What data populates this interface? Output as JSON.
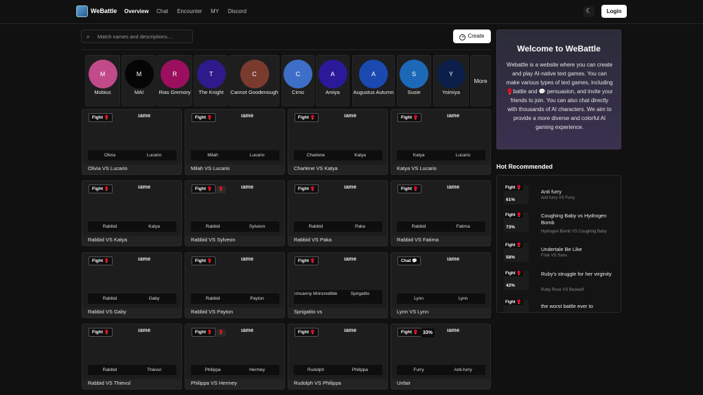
{
  "header": {
    "brand": "WeBattle",
    "nav": [
      "Overview",
      "Chat",
      "Encounter",
      "MY",
      "Discord"
    ],
    "login_label": "Login",
    "theme_icon": "moon-icon"
  },
  "toolbar": {
    "search_placeholder": "Match names and descriptions....",
    "create_label": "Create"
  },
  "characters": [
    {
      "initial": "M",
      "name": "Mobius",
      "color": "#c04a8a"
    },
    {
      "initial": "M",
      "name": "MAI",
      "color": "#050505"
    },
    {
      "initial": "R",
      "name": "Rias Gremory",
      "color": "#9c0f5f"
    },
    {
      "initial": "T",
      "name": "The Knight",
      "color": "#2e1a8a"
    },
    {
      "initial": "C",
      "name": "Cannot Goodenough",
      "color": "#7a3b2e"
    },
    {
      "initial": "C",
      "name": "Cirno",
      "color": "#3e6fc8"
    },
    {
      "initial": "A",
      "name": "Amiya",
      "color": "#2a1a9a"
    },
    {
      "initial": "A",
      "name": "Augustus Autumn",
      "color": "#1a4ab0"
    },
    {
      "initial": "S",
      "name": "Susie",
      "color": "#1e68b8"
    },
    {
      "initial": "Y",
      "name": "Yoimiya",
      "color": "#0b1f4a"
    }
  ],
  "more_label": "More",
  "ghost_text": "ıame",
  "cards": [
    {
      "type": "Fight",
      "a": "Olivia",
      "b": "Lucario",
      "title": "Olivia VS Lucario"
    },
    {
      "type": "Fight",
      "a": "Milah",
      "b": "Lucario",
      "title": "Milah VS Lucario"
    },
    {
      "type": "Fight",
      "a": "Charlene",
      "b": "Katya",
      "title": "Charlene VS Katya"
    },
    {
      "type": "Fight",
      "a": "Katya",
      "b": "Lucario",
      "title": "Katya VS Lucario"
    },
    {
      "type": "Fight",
      "a": "Rabbid",
      "b": "Katya",
      "title": "Rabbid VS Katya"
    },
    {
      "type": "Fight",
      "a": "Rabbid",
      "b": "Sylveon",
      "title": "Rabbid VS Sylveon",
      "extra": true
    },
    {
      "type": "Fight",
      "a": "Rabbid",
      "b": "Paka",
      "title": "Rabbid VS Paka"
    },
    {
      "type": "Fight",
      "a": "Rabbid",
      "b": "Fatima",
      "title": "Rabbid VS Fatima"
    },
    {
      "type": "Fight",
      "a": "Rabbid",
      "b": "Gaby",
      "title": "Rabbid VS Gaby"
    },
    {
      "type": "Fight",
      "a": "Rabbid",
      "b": "Payton",
      "title": "Rabbid VS Payton"
    },
    {
      "type": "Fight",
      "a": "Uncanny Mrincredible",
      "b": "Sprigatito",
      "title": "Sprigatito vs",
      "tall": true
    },
    {
      "type": "Chat",
      "a": "Lynn",
      "b": "Lynn",
      "title": "Lynn VS Lynn"
    },
    {
      "type": "Fight",
      "a": "Rabbid",
      "b": "Thievul",
      "title": "Rabbid VS Thievul"
    },
    {
      "type": "Fight",
      "a": "Philippa",
      "b": "Hermey",
      "title": "Philippa VS Hermey",
      "extra": true
    },
    {
      "type": "Fight",
      "a": "Rudolph",
      "b": "Philippa",
      "title": "Rudolph VS Philippa"
    },
    {
      "type": "Fight",
      "a": "Furry",
      "b": "Anti-furry",
      "title": "Unfair",
      "pct": "33%"
    }
  ],
  "welcome": {
    "title": "Welcome to WeBattle",
    "text": "Webattle is a website where you can create and play AI-native text games. You can make various types of text games, including 🥊battle and 💬 persuasion, and invite your friends to join. You can also chat directly with thousands of AI characters. We aim to provide a more diverse and colorful AI gaming experience."
  },
  "hot": {
    "title": "Hot Recommended",
    "items": [
      {
        "pct": "61%",
        "title": "Anti furry",
        "sub": "Anti furry VS Furry"
      },
      {
        "pct": "73%",
        "title": "Coughing Baby vs Hydrogen Bomb",
        "sub": "Hydrogen Bomb VS Coughing Baby"
      },
      {
        "pct": "58%",
        "title": "Undertale Be Like",
        "sub": "Frisk VS Sans"
      },
      {
        "pct": "42%",
        "title": "Ruby's struggle for her virginity",
        "sub": "Ruby Rose VS Beowolf"
      },
      {
        "pct": "",
        "title": "the worst battle ever to",
        "sub": ""
      }
    ]
  }
}
